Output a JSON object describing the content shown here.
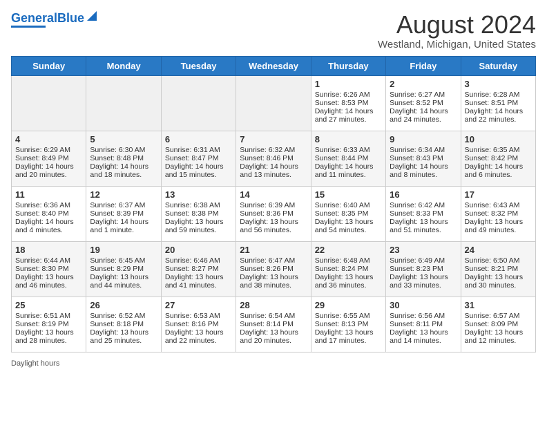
{
  "header": {
    "logo_general": "General",
    "logo_blue": "Blue",
    "month_title": "August 2024",
    "location": "Westland, Michigan, United States"
  },
  "days_of_week": [
    "Sunday",
    "Monday",
    "Tuesday",
    "Wednesday",
    "Thursday",
    "Friday",
    "Saturday"
  ],
  "weeks": [
    [
      {
        "day": "",
        "sunrise": "",
        "sunset": "",
        "daylight": "",
        "empty": true
      },
      {
        "day": "",
        "sunrise": "",
        "sunset": "",
        "daylight": "",
        "empty": true
      },
      {
        "day": "",
        "sunrise": "",
        "sunset": "",
        "daylight": "",
        "empty": true
      },
      {
        "day": "",
        "sunrise": "",
        "sunset": "",
        "daylight": "",
        "empty": true
      },
      {
        "day": "1",
        "sunrise": "Sunrise: 6:26 AM",
        "sunset": "Sunset: 8:53 PM",
        "daylight": "Daylight: 14 hours and 27 minutes."
      },
      {
        "day": "2",
        "sunrise": "Sunrise: 6:27 AM",
        "sunset": "Sunset: 8:52 PM",
        "daylight": "Daylight: 14 hours and 24 minutes."
      },
      {
        "day": "3",
        "sunrise": "Sunrise: 6:28 AM",
        "sunset": "Sunset: 8:51 PM",
        "daylight": "Daylight: 14 hours and 22 minutes."
      }
    ],
    [
      {
        "day": "4",
        "sunrise": "Sunrise: 6:29 AM",
        "sunset": "Sunset: 8:49 PM",
        "daylight": "Daylight: 14 hours and 20 minutes."
      },
      {
        "day": "5",
        "sunrise": "Sunrise: 6:30 AM",
        "sunset": "Sunset: 8:48 PM",
        "daylight": "Daylight: 14 hours and 18 minutes."
      },
      {
        "day": "6",
        "sunrise": "Sunrise: 6:31 AM",
        "sunset": "Sunset: 8:47 PM",
        "daylight": "Daylight: 14 hours and 15 minutes."
      },
      {
        "day": "7",
        "sunrise": "Sunrise: 6:32 AM",
        "sunset": "Sunset: 8:46 PM",
        "daylight": "Daylight: 14 hours and 13 minutes."
      },
      {
        "day": "8",
        "sunrise": "Sunrise: 6:33 AM",
        "sunset": "Sunset: 8:44 PM",
        "daylight": "Daylight: 14 hours and 11 minutes."
      },
      {
        "day": "9",
        "sunrise": "Sunrise: 6:34 AM",
        "sunset": "Sunset: 8:43 PM",
        "daylight": "Daylight: 14 hours and 8 minutes."
      },
      {
        "day": "10",
        "sunrise": "Sunrise: 6:35 AM",
        "sunset": "Sunset: 8:42 PM",
        "daylight": "Daylight: 14 hours and 6 minutes."
      }
    ],
    [
      {
        "day": "11",
        "sunrise": "Sunrise: 6:36 AM",
        "sunset": "Sunset: 8:40 PM",
        "daylight": "Daylight: 14 hours and 4 minutes."
      },
      {
        "day": "12",
        "sunrise": "Sunrise: 6:37 AM",
        "sunset": "Sunset: 8:39 PM",
        "daylight": "Daylight: 14 hours and 1 minute."
      },
      {
        "day": "13",
        "sunrise": "Sunrise: 6:38 AM",
        "sunset": "Sunset: 8:38 PM",
        "daylight": "Daylight: 13 hours and 59 minutes."
      },
      {
        "day": "14",
        "sunrise": "Sunrise: 6:39 AM",
        "sunset": "Sunset: 8:36 PM",
        "daylight": "Daylight: 13 hours and 56 minutes."
      },
      {
        "day": "15",
        "sunrise": "Sunrise: 6:40 AM",
        "sunset": "Sunset: 8:35 PM",
        "daylight": "Daylight: 13 hours and 54 minutes."
      },
      {
        "day": "16",
        "sunrise": "Sunrise: 6:42 AM",
        "sunset": "Sunset: 8:33 PM",
        "daylight": "Daylight: 13 hours and 51 minutes."
      },
      {
        "day": "17",
        "sunrise": "Sunrise: 6:43 AM",
        "sunset": "Sunset: 8:32 PM",
        "daylight": "Daylight: 13 hours and 49 minutes."
      }
    ],
    [
      {
        "day": "18",
        "sunrise": "Sunrise: 6:44 AM",
        "sunset": "Sunset: 8:30 PM",
        "daylight": "Daylight: 13 hours and 46 minutes."
      },
      {
        "day": "19",
        "sunrise": "Sunrise: 6:45 AM",
        "sunset": "Sunset: 8:29 PM",
        "daylight": "Daylight: 13 hours and 44 minutes."
      },
      {
        "day": "20",
        "sunrise": "Sunrise: 6:46 AM",
        "sunset": "Sunset: 8:27 PM",
        "daylight": "Daylight: 13 hours and 41 minutes."
      },
      {
        "day": "21",
        "sunrise": "Sunrise: 6:47 AM",
        "sunset": "Sunset: 8:26 PM",
        "daylight": "Daylight: 13 hours and 38 minutes."
      },
      {
        "day": "22",
        "sunrise": "Sunrise: 6:48 AM",
        "sunset": "Sunset: 8:24 PM",
        "daylight": "Daylight: 13 hours and 36 minutes."
      },
      {
        "day": "23",
        "sunrise": "Sunrise: 6:49 AM",
        "sunset": "Sunset: 8:23 PM",
        "daylight": "Daylight: 13 hours and 33 minutes."
      },
      {
        "day": "24",
        "sunrise": "Sunrise: 6:50 AM",
        "sunset": "Sunset: 8:21 PM",
        "daylight": "Daylight: 13 hours and 30 minutes."
      }
    ],
    [
      {
        "day": "25",
        "sunrise": "Sunrise: 6:51 AM",
        "sunset": "Sunset: 8:19 PM",
        "daylight": "Daylight: 13 hours and 28 minutes."
      },
      {
        "day": "26",
        "sunrise": "Sunrise: 6:52 AM",
        "sunset": "Sunset: 8:18 PM",
        "daylight": "Daylight: 13 hours and 25 minutes."
      },
      {
        "day": "27",
        "sunrise": "Sunrise: 6:53 AM",
        "sunset": "Sunset: 8:16 PM",
        "daylight": "Daylight: 13 hours and 22 minutes."
      },
      {
        "day": "28",
        "sunrise": "Sunrise: 6:54 AM",
        "sunset": "Sunset: 8:14 PM",
        "daylight": "Daylight: 13 hours and 20 minutes."
      },
      {
        "day": "29",
        "sunrise": "Sunrise: 6:55 AM",
        "sunset": "Sunset: 8:13 PM",
        "daylight": "Daylight: 13 hours and 17 minutes."
      },
      {
        "day": "30",
        "sunrise": "Sunrise: 6:56 AM",
        "sunset": "Sunset: 8:11 PM",
        "daylight": "Daylight: 13 hours and 14 minutes."
      },
      {
        "day": "31",
        "sunrise": "Sunrise: 6:57 AM",
        "sunset": "Sunset: 8:09 PM",
        "daylight": "Daylight: 13 hours and 12 minutes."
      }
    ]
  ],
  "footer": {
    "daylight_label": "Daylight hours"
  },
  "colors": {
    "header_bg": "#2979c5",
    "accent": "#1a6bbf"
  }
}
